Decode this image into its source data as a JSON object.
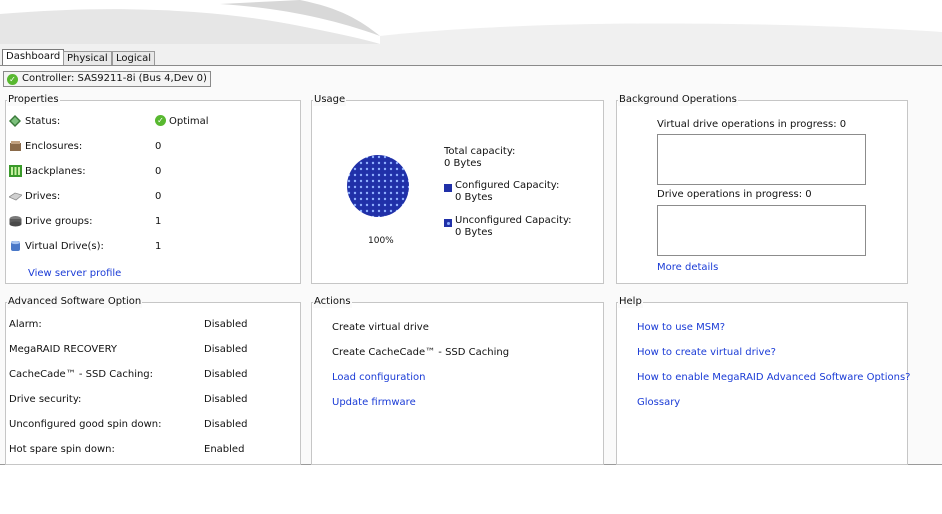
{
  "tabs": [
    "Dashboard",
    "Physical",
    "Logical"
  ],
  "controller": {
    "label": "Controller:  SAS9211-8i (Bus 4,Dev 0)"
  },
  "properties": {
    "title": "Properties",
    "rows": [
      {
        "label": "Status:",
        "value": "Optimal",
        "icon": "diamond-icon"
      },
      {
        "label": "Enclosures:",
        "value": "0",
        "icon": "enclosure-icon"
      },
      {
        "label": "Backplanes:",
        "value": "0",
        "icon": "backplane-icon"
      },
      {
        "label": "Drives:",
        "value": "0",
        "icon": "drive-icon"
      },
      {
        "label": "Drive groups:",
        "value": "1",
        "icon": "drive-group-icon"
      },
      {
        "label": "Virtual Drive(s):",
        "value": "1",
        "icon": "virtual-drive-icon"
      }
    ],
    "link": "View server profile"
  },
  "usage": {
    "title": "Usage",
    "pie_percent_label": "100%",
    "total_label": "Total capacity:",
    "total_value": "0 Bytes",
    "configured_label": "Configured Capacity:",
    "configured_value": "0 Bytes",
    "unconfigured_label": "Unconfigured Capacity:",
    "unconfigured_value": "0 Bytes",
    "colors": {
      "configured": "#2030a8",
      "pattern_dot": "#8fb0ff"
    }
  },
  "background_ops": {
    "title": "Background Operations",
    "vd_label": "Virtual drive operations in progress: 0",
    "drive_label": "Drive operations in progress: 0",
    "link": "More details"
  },
  "advanced": {
    "title": "Advanced Software Option",
    "rows": [
      {
        "label": "Alarm:",
        "value": "Disabled"
      },
      {
        "label": "MegaRAID RECOVERY",
        "value": "Disabled"
      },
      {
        "label": "CacheCade™ - SSD Caching:",
        "value": "Disabled"
      },
      {
        "label": "Drive security:",
        "value": "Disabled"
      },
      {
        "label": "Unconfigured good spin down:",
        "value": "Disabled"
      },
      {
        "label": "Hot spare spin down:",
        "value": "Enabled"
      }
    ]
  },
  "actions": {
    "title": "Actions",
    "items": [
      "Create virtual drive",
      "Create CacheCade™ - SSD Caching",
      "Load configuration",
      "Update firmware"
    ]
  },
  "help": {
    "title": "Help",
    "items": [
      "How to use MSM?",
      "How to create virtual drive?",
      "How to enable MegaRAID Advanced Software Options?",
      "Glossary"
    ]
  },
  "colors": {
    "link": "#1a3bd6",
    "status_ok": "#58b830",
    "accent": "#2030a8"
  }
}
